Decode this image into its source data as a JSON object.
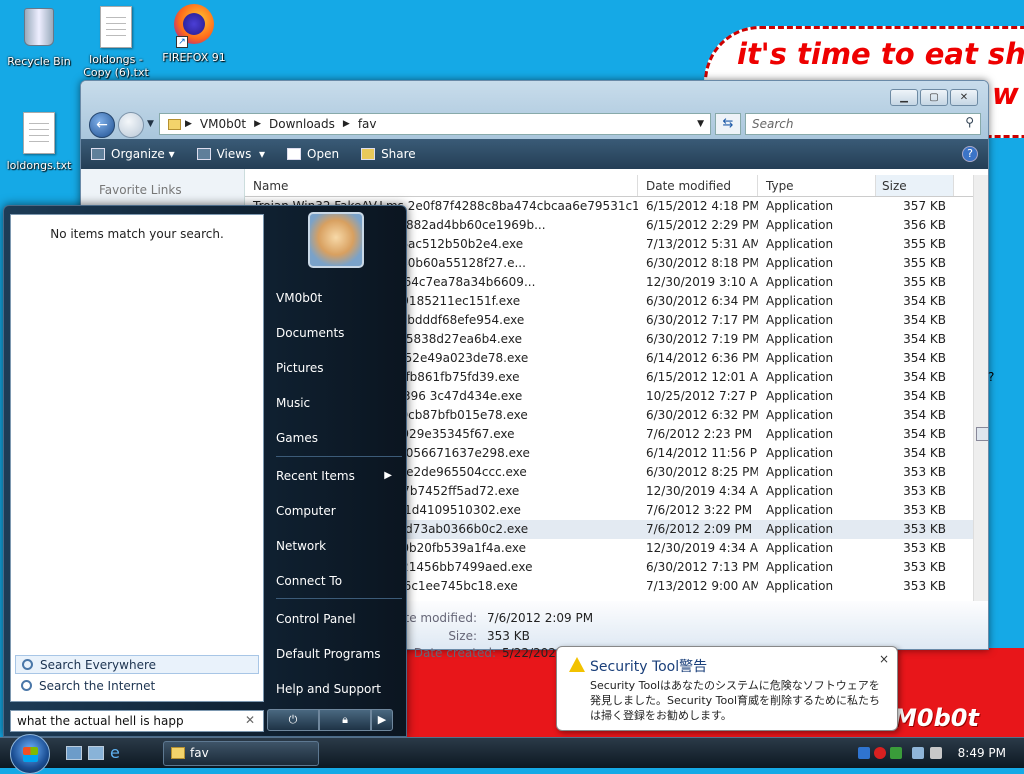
{
  "desktop": {
    "icons": [
      {
        "label": "Recycle Bin"
      },
      {
        "label": "loldongs - Copy (6).txt"
      },
      {
        "label": "FIREFOX 91"
      },
      {
        "label": "loldongs.txt"
      }
    ],
    "bubble_text": "it's time to eat shit",
    "bubble_partial": "w",
    "red_banner_text": "M0b0t"
  },
  "explorer": {
    "breadcrumb": [
      "VM0b0t",
      "Downloads",
      "fav"
    ],
    "search_placeholder": "Search",
    "toolbar": {
      "organize": "Organize",
      "views": "Views",
      "open": "Open",
      "share": "Share"
    },
    "sidebar": {
      "favorite_links": "Favorite Links"
    },
    "columns": {
      "name": "Name",
      "date": "Date modified",
      "type": "Type",
      "size": "Size"
    },
    "rows": [
      {
        "name": "Trojan.Win32.FakeAV.Lms.2e0f87f4288c8ba474cbcaa6e79531c1.exe",
        "date": "6/15/2012 4:18 PM",
        "type": "Application",
        "size": "357 KB"
      },
      {
        "name": "SmartFortress2012.hdn.4882ad4bb60ce1969b...",
        "date": "6/15/2012 2:29 PM",
        "type": "Application",
        "size": "356 KB"
      },
      {
        "name": "w.16c8e4db8c9c31df16f6ac512b50b2e4.exe",
        "date": "7/13/2012 5:31 AM",
        "type": "Application",
        "size": "355 KB"
      },
      {
        "name": "hy.ac5cf2bd6bb7d90ec340b60a55128f27.e...",
        "date": "6/30/2012 8:18 PM",
        "type": "Application",
        "size": "355 KB"
      },
      {
        "name": "ecurityShield.oo.4bf42b964c7ea78a34b6609...",
        "date": "12/30/2019 3:10 AM",
        "type": "Application",
        "size": "355 KB"
      },
      {
        "name": "z.bcfa6d8c9c16b7b53329185211ec151f.exe",
        "date": "6/30/2012 6:34 PM",
        "type": "Application",
        "size": "354 KB"
      },
      {
        "name": "m.8dc5c2ceca7b07ece47bdddf68efe954.exe",
        "date": "6/30/2012 7:17 PM",
        "type": "Application",
        "size": "354 KB"
      },
      {
        "name": "l.e21f497c5210986cec005838d27ea6b4.exe",
        "date": "6/30/2012 7:19 PM",
        "type": "Application",
        "size": "354 KB"
      },
      {
        "name": "u.253f2ad1878a9aa065e52e49a023de78.exe",
        "date": "6/14/2012 6:36 PM",
        "type": "Application",
        "size": "354 KB"
      },
      {
        "name": "u.adc900c9bb694ad6cbafb861fb75fd39.exe",
        "date": "6/15/2012 12:01 AM",
        "type": "Application",
        "size": "354 KB"
      },
      {
        "name": "u.ffbba90f8f1104448378396 3c47d434e.exe",
        "date": "10/25/2012 7:27 PM",
        "type": "Application",
        "size": "354 KB"
      },
      {
        "name": "e.b38153163bbb262c440cb87bfb015e78.exe",
        "date": "6/30/2012 6:32 PM",
        "type": "Application",
        "size": "354 KB"
      },
      {
        "name": "ef513a4516ba88d1322d929e35345f67.exe",
        "date": "7/6/2012 2:23 PM",
        "type": "Application",
        "size": "354 KB"
      },
      {
        "name": "q.9b623a928f94b886397056671637e298.exe",
        "date": "6/14/2012 11:56 PM",
        "type": "Application",
        "size": "354 KB"
      },
      {
        "name": "n.c9d51320e959cb2dc65e2de965504ccc.exe",
        "date": "6/30/2012 8:25 PM",
        "type": "Application",
        "size": "353 KB"
      },
      {
        "name": "r.6949dc7c278c9bb1e0d7b7452ff5ad72.exe",
        "date": "12/30/2019 4:34 AM",
        "type": "Application",
        "size": "353 KB"
      },
      {
        "name": "e37052997442147a519c1d4109510302.exe",
        "date": "7/6/2012 3:22 PM",
        "type": "Application",
        "size": "353 KB"
      },
      {
        "name": "b.1babb5a0f708386a735d73ab0366b0c2.exe",
        "date": "7/6/2012 2:09 PM",
        "type": "Application",
        "size": "353 KB"
      },
      {
        "name": "m.447932fb6337bcb89d0b20fb539a1f4a.exe",
        "date": "12/30/2019 4:34 AM",
        "type": "Application",
        "size": "353 KB"
      },
      {
        "name": "x.e3d3503759030b329621456bb7499aed.exe",
        "date": "6/30/2012 7:13 PM",
        "type": "Application",
        "size": "353 KB"
      },
      {
        "name": "l.b31861e9c793f10f241c6c1ee745bc18.exe",
        "date": "7/13/2012 9:00 AM",
        "type": "Application",
        "size": "353 KB"
      }
    ],
    "selected_row": 17,
    "details": {
      "date_modified_label": "Date modified:",
      "date_modified": "7/6/2012 2:09 PM",
      "size_label": "Size:",
      "size": "353 KB",
      "date_created_label": "Date created:",
      "date_created": "5/22/2022"
    }
  },
  "start_menu": {
    "no_items": "No items match your search.",
    "search_everywhere": "Search Everywhere",
    "search_internet": "Search the Internet",
    "search_value": "what the actual hell is happ",
    "right_items": [
      "VM0b0t",
      "Documents",
      "Pictures",
      "Music",
      "Games",
      "Recent Items",
      "Computer",
      "Network",
      "Connect To",
      "Control Panel",
      "Default Programs",
      "Help and Support"
    ]
  },
  "balloon": {
    "title": "Security Tool警告",
    "message": "Security Toolはあなたのシステムに危険なソフトウェアを発見しました。Security Tool育威を削除するために私たちは掃く登録をお勧めします。",
    "close": "×"
  },
  "taskbar": {
    "task_label": "fav",
    "clock": "8:49 PM"
  }
}
